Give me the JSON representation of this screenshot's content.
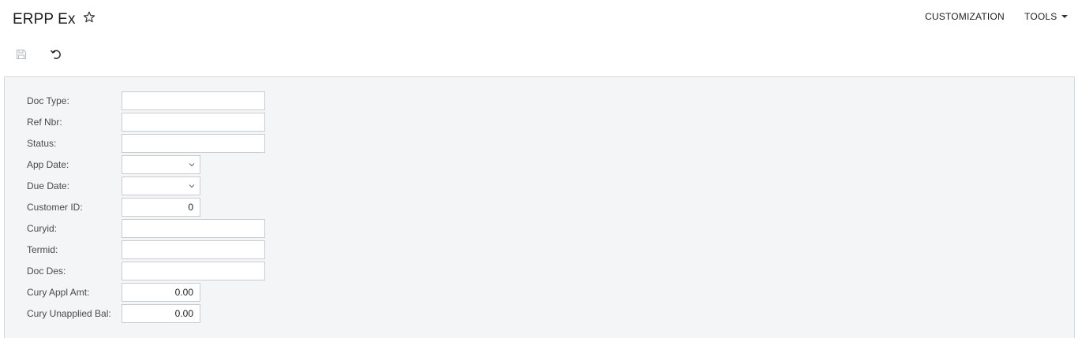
{
  "header": {
    "title": "ERPP Ex",
    "customization_label": "CUSTOMIZATION",
    "tools_label": "TOOLS"
  },
  "toolbar": {
    "save_icon": "save-icon",
    "undo_icon": "undo-icon"
  },
  "form": {
    "doc_type": {
      "label": "Doc Type:",
      "value": ""
    },
    "ref_nbr": {
      "label": "Ref Nbr:",
      "value": ""
    },
    "status": {
      "label": "Status:",
      "value": ""
    },
    "app_date": {
      "label": "App Date:",
      "value": ""
    },
    "due_date": {
      "label": "Due Date:",
      "value": ""
    },
    "customer_id": {
      "label": "Customer ID:",
      "value": "0"
    },
    "curyid": {
      "label": "Curyid:",
      "value": ""
    },
    "termid": {
      "label": "Termid:",
      "value": ""
    },
    "doc_des": {
      "label": "Doc Des:",
      "value": ""
    },
    "cury_appl_amt": {
      "label": "Cury Appl Amt:",
      "value": "0.00"
    },
    "cury_unapplied_bal": {
      "label": "Cury Unapplied Bal:",
      "value": "0.00"
    }
  },
  "colors": {
    "panel_bg": "#f3f5f6",
    "border": "#c9cdd1",
    "text": "#1f1f1f"
  }
}
